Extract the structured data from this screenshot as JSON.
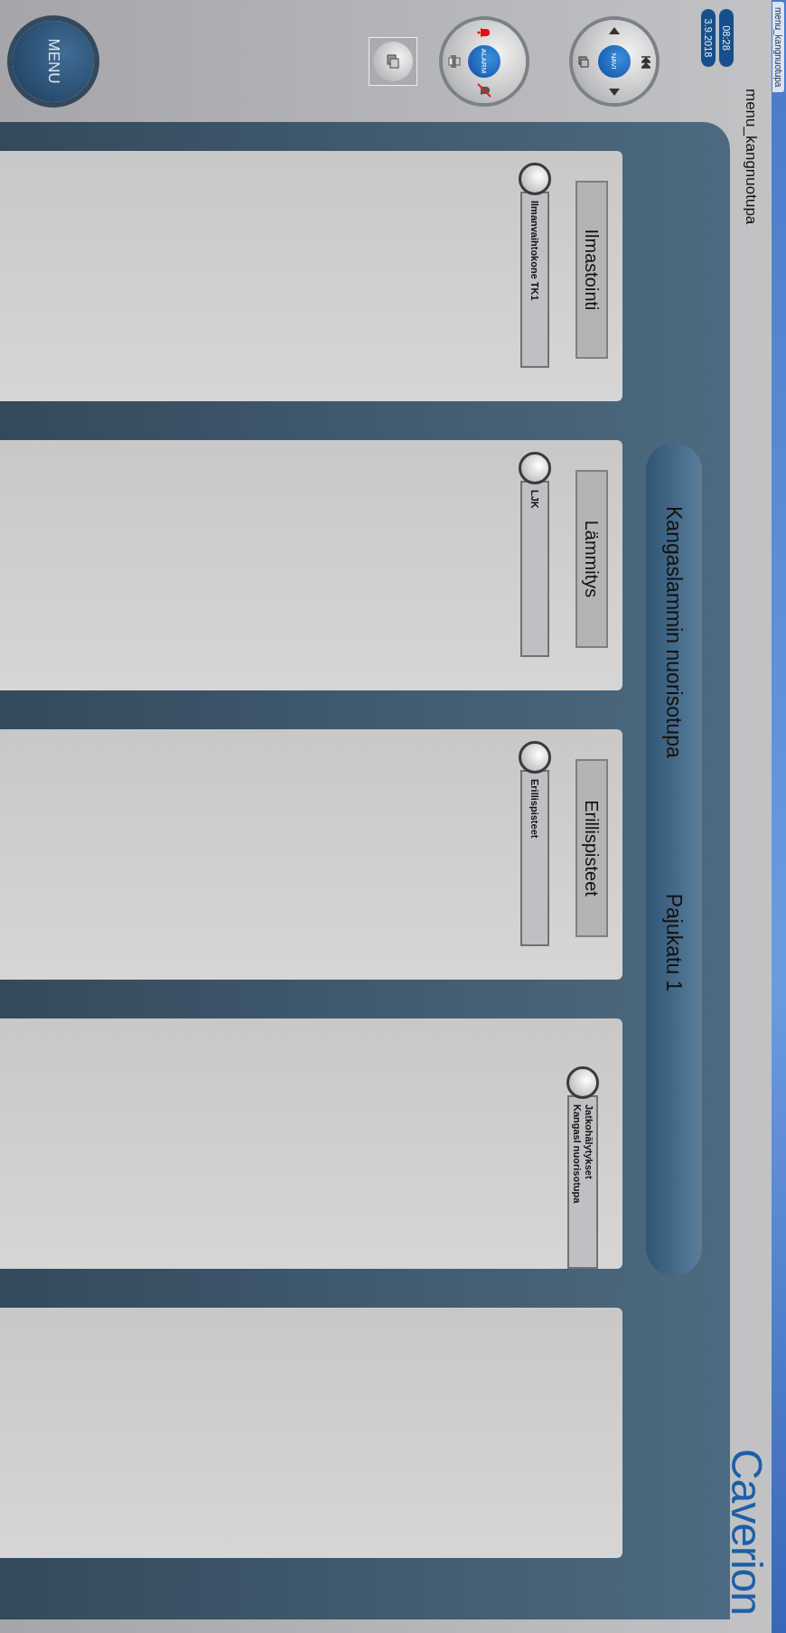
{
  "browser_tab": {
    "title": "menu_kangnuotupa"
  },
  "header": {
    "title": "menu_kangnuotupa",
    "logo": "Caverion"
  },
  "clock": {
    "time": "08:28",
    "date": "3.9.2018"
  },
  "navi": {
    "label": "NAVI"
  },
  "alarm": {
    "label": "ALARM"
  },
  "menu": {
    "label": "MENU"
  },
  "banner": {
    "name": "Kangaslammin nuorisotupa",
    "address": "Pajukatu 1"
  },
  "cards": [
    {
      "kind": "group",
      "title": "Ilmastointi",
      "items": [
        {
          "lines": [
            "Ilmanvaihtokone TK1"
          ]
        }
      ]
    },
    {
      "kind": "group",
      "title": "Lämmitys",
      "items": [
        {
          "lines": [
            "LJK"
          ]
        }
      ]
    },
    {
      "kind": "group",
      "title": "Erillispisteet",
      "items": [
        {
          "lines": [
            "Erillispisteet"
          ]
        }
      ]
    },
    {
      "kind": "group",
      "items": [
        {
          "lines": [
            "Jatkohälytykset",
            "Kangasl nuorisotupa"
          ]
        }
      ]
    },
    {
      "kind": "blank"
    }
  ]
}
